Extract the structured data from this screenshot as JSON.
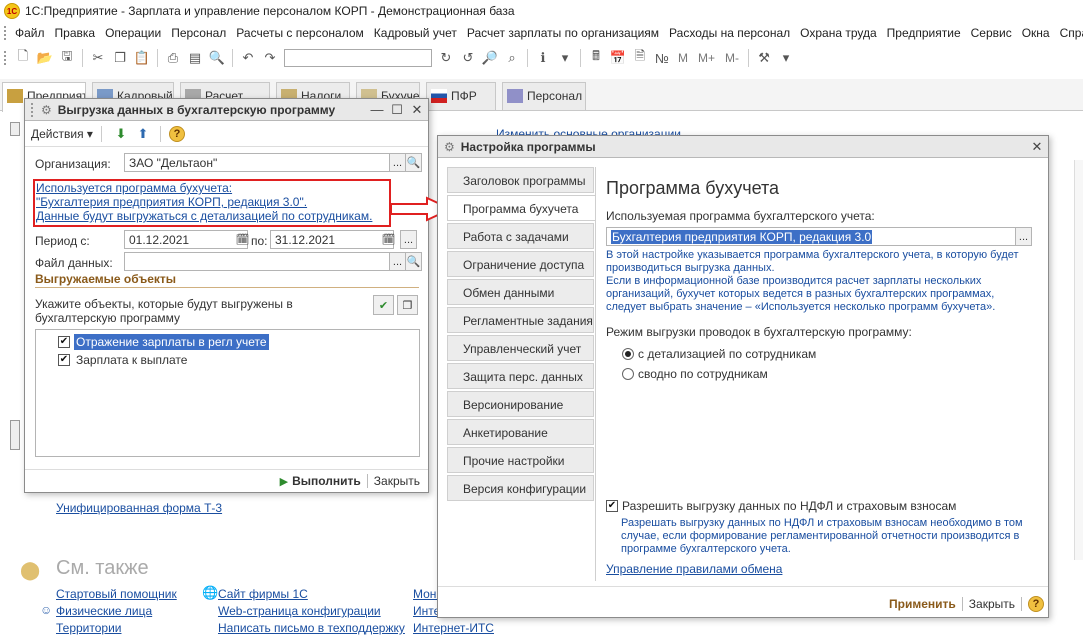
{
  "app": {
    "title": "1С:Предприятие - Зарплата и управление персоналом КОРП - Демонстрационная база",
    "logo_text": "1С"
  },
  "menu": [
    "Файл",
    "Правка",
    "Операции",
    "Персонал",
    "Расчеты с персоналом",
    "Кадровый учет",
    "Расчет зарплаты по организациям",
    "Расходы на персонал",
    "Охрана труда",
    "Предприятие",
    "Сервис",
    "Окна",
    "Справка"
  ],
  "toolbar": {
    "m": "M",
    "m_plus": "M+",
    "m_minus": "M-"
  },
  "sections": [
    {
      "label": "Предприятие"
    },
    {
      "label": "Кадровый"
    },
    {
      "label": "Расчет"
    },
    {
      "label": "Налоги"
    },
    {
      "label": "Бухучет"
    },
    {
      "label": "ПФР"
    },
    {
      "label": "Персонал"
    }
  ],
  "background": {
    "link_top": "Изменить основные организации",
    "link_t3": "Унифицированная форма Т-3",
    "see_also": "См. также",
    "links_col1": [
      "Стартовый помощник",
      "Физические лица",
      "Территории"
    ],
    "links_col2": [
      "Сайт фирмы 1С",
      "Web-страница конфигурации",
      "Написать письмо в техподдержку"
    ],
    "links_col3": [
      "Мони",
      "Интер",
      "Интернет-ИТС"
    ]
  },
  "export_dialog": {
    "title": "Выгрузка данных в бухгалтерскую программу",
    "actions_label": "Действия",
    "org_label": "Организация:",
    "org_value": "ЗАО \"Дельтаон\"",
    "info_line1": "Используется программа бухучета:",
    "info_line2": "\"Бухгалтерия предприятия КОРП, редакция 3.0\".",
    "info_line3": "Данные будут выгружаться с детализацией по сотрудникам.",
    "period_label": "Период с:",
    "period_from": "01.12.2021",
    "period_to_label": "по:",
    "period_to": "31.12.2021",
    "file_label": "Файл данных:",
    "file_value": "",
    "objects_header": "Выгружаемые объекты",
    "objects_hint": "Укажите объекты, которые будут выгружены в бухгалтерскую программу",
    "objects": [
      {
        "label": "Отражение зарплаты в регл учете",
        "checked": true
      },
      {
        "label": "Зарплата к выплате",
        "checked": true
      }
    ],
    "run_label": "Выполнить",
    "close_label": "Закрыть"
  },
  "settings_dialog": {
    "title": "Настройка программы",
    "nav": [
      "Заголовок программы",
      "Программа бухучета",
      "Работа с задачами",
      "Ограничение доступа",
      "Обмен данными",
      "Регламентные задания",
      "Управленческий учет",
      "Защита перс. данных",
      "Версионирование",
      "Анкетирование",
      "Прочие настройки",
      "Версия конфигурации"
    ],
    "active_nav": 1,
    "heading": "Программа бухучета",
    "program_label": "Используемая программа бухгалтерского учета:",
    "program_value": "Бухгалтерия предприятия КОРП, редакция 3.0",
    "desc1": "В этой настройке указывается программа бухгалтерского учета, в которую будет производиться выгрузка данных.",
    "desc2": "Если в информационной базе производится расчет зарплаты нескольких организаций, бухучет которых ведется в разных бухгалтерских программах, следует выбрать значение – «Используется несколько программ бухучета».",
    "mode_label": "Режим выгрузки проводок в бухгалтерскую программу:",
    "mode_options": [
      "с детализацией по сотрудникам",
      "сводно по сотрудникам"
    ],
    "mode_selected": 0,
    "ndfl_label": "Разрешить выгрузку данных по НДФЛ и страховым взносам",
    "ndfl_checked": true,
    "ndfl_desc": "Разрешать выгрузку данных по НДФЛ и страховым взносам необходимо в том случае, если формирование регламентированной отчетности производится в программе бухгалтерского учета.",
    "exchange_link": "Управление правилами обмена",
    "apply_label": "Применить",
    "close_label": "Закрыть"
  },
  "colors": {
    "link": "#1a4ea0",
    "accent_green": "#2e8b2e",
    "highlight_red": "#e02020",
    "selection": "#3d6fc6",
    "section_header": "#8a5a1a"
  }
}
